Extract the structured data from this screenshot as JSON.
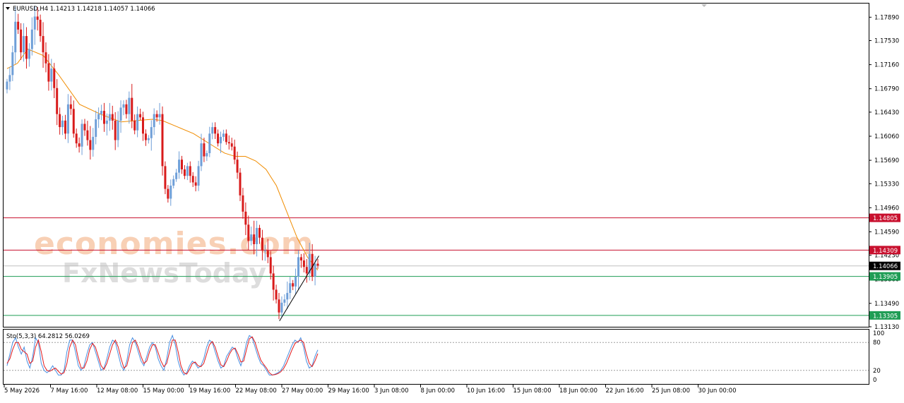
{
  "header": {
    "symbol_line": "EURUSD,H4  1.14213 1.14218 1.14057 1.14066"
  },
  "watermark": {
    "line1": "economies.com",
    "line2": "FxNewsToday"
  },
  "colors": {
    "bull": "#6f9fd8",
    "bear": "#d81b1b",
    "ma": "#f08c00",
    "resistance": "#c8102e",
    "support": "#1f9d55",
    "trendline": "#000000",
    "stoch_main": "#4a90e2",
    "stoch_signal": "#e31a1c"
  },
  "chart_data": [
    {
      "type": "candlestick",
      "title": "EURUSD,H4",
      "ohlc_readout": {
        "open": 1.14213,
        "high": 1.14218,
        "low": 1.14057,
        "close": 1.14066
      },
      "ylim": [
        1.1313,
        1.181
      ],
      "y_ticks": [
        "1.17890",
        "1.17530",
        "1.17160",
        "1.16790",
        "1.16430",
        "1.16060",
        "1.15690",
        "1.15330",
        "1.14960",
        "1.14590",
        "1.14230",
        "1.13860",
        "1.13490",
        "1.13130"
      ],
      "x_tick_labels": [
        "5 May 2026",
        "7 May 16:00",
        "12 May 08:00",
        "15 May 00:00",
        "19 May 16:00",
        "22 May 08:00",
        "27 May 00:00",
        "29 May 16:00",
        "3 Jun 08:00",
        "8 Jun 00:00",
        "10 Jun 16:00",
        "15 Jun 08:00",
        "18 Jun 00:00",
        "22 Jun 16:00",
        "25 Jun 08:00",
        "30 Jun 00:00"
      ],
      "series_close": [
        1.169,
        1.17,
        1.1735,
        1.1782,
        1.177,
        1.1735,
        1.176,
        1.1725,
        1.174,
        1.177,
        1.179,
        1.1785,
        1.176,
        1.1735,
        1.1718,
        1.169,
        1.171,
        1.168,
        1.164,
        1.162,
        1.163,
        1.161,
        1.1655,
        1.1648,
        1.161,
        1.1595,
        1.159,
        1.1625,
        1.1615,
        1.16,
        1.1585,
        1.1605,
        1.1632,
        1.164,
        1.1645,
        1.1625,
        1.163,
        1.164,
        1.163,
        1.16,
        1.163,
        1.165,
        1.1655,
        1.164,
        1.1665,
        1.163,
        1.1615,
        1.164,
        1.1635,
        1.161,
        1.16,
        1.1603,
        1.162,
        1.164,
        1.1635,
        1.164,
        1.156,
        1.1525,
        1.151,
        1.153,
        1.154,
        1.155,
        1.157,
        1.1555,
        1.1545,
        1.156,
        1.1545,
        1.1535,
        1.153,
        1.156,
        1.1595,
        1.1575,
        1.158,
        1.161,
        1.162,
        1.161,
        1.1595,
        1.1605,
        1.161,
        1.1597,
        1.1595,
        1.159,
        1.157,
        1.155,
        1.1515,
        1.149,
        1.147,
        1.1445,
        1.1455,
        1.144,
        1.1465,
        1.145,
        1.143,
        1.143,
        1.142,
        1.1395,
        1.137,
        1.1355,
        1.1335,
        1.135,
        1.1355,
        1.1365,
        1.138,
        1.1375,
        1.139,
        1.142,
        1.1415,
        1.1405,
        1.1395,
        1.1425,
        1.139,
        1.141,
        1.1407
      ],
      "moving_average": {
        "points": [
          [
            0,
            1.171
          ],
          [
            10,
            1.1718
          ],
          [
            20,
            1.174
          ],
          [
            35,
            1.173
          ],
          [
            50,
            1.17
          ],
          [
            70,
            1.1655
          ],
          [
            90,
            1.164
          ],
          [
            110,
            1.1628
          ],
          [
            125,
            1.163
          ],
          [
            140,
            1.1632
          ],
          [
            150,
            1.163
          ],
          [
            165,
            1.162
          ],
          [
            180,
            1.161
          ],
          [
            200,
            1.159
          ],
          [
            210,
            1.158
          ],
          [
            220,
            1.1575
          ],
          [
            230,
            1.1575
          ],
          [
            240,
            1.1568
          ],
          [
            250,
            1.1555
          ],
          [
            260,
            1.153
          ],
          [
            270,
            1.149
          ],
          [
            280,
            1.145
          ],
          [
            290,
            1.142
          ],
          [
            300,
            1.14
          ]
        ]
      },
      "price_lines": [
        {
          "value": 1.14805,
          "label": "1.14805",
          "kind": "resistance"
        },
        {
          "value": 1.14309,
          "label": "1.14309",
          "kind": "resistance"
        },
        {
          "value": 1.14066,
          "label": "1.14066",
          "kind": "current"
        },
        {
          "value": 1.13905,
          "label": "1.13905",
          "kind": "support"
        },
        {
          "value": 1.13305,
          "label": "1.13305",
          "kind": "support"
        }
      ],
      "trendline": {
        "from": [
          263,
          1.1322
        ],
        "to": [
          301,
          1.1422
        ]
      }
    },
    {
      "type": "line",
      "title": "Sto(5,3,3) 64.2812 56.0269",
      "ylim": [
        0,
        100
      ],
      "y_ticks": [
        "100",
        "80",
        "20",
        "0"
      ],
      "levels": [
        20,
        80
      ],
      "series": [
        {
          "name": "%K",
          "values": [
            30,
            55,
            80,
            90,
            70,
            55,
            70,
            40,
            25,
            50,
            90,
            80,
            35,
            20,
            15,
            20,
            30,
            20,
            10,
            10,
            20,
            60,
            85,
            85,
            60,
            30,
            20,
            30,
            55,
            75,
            80,
            60,
            40,
            20,
            25,
            45,
            70,
            85,
            80,
            55,
            30,
            20,
            40,
            75,
            90,
            80,
            60,
            40,
            30,
            50,
            70,
            80,
            70,
            45,
            30,
            20,
            45,
            80,
            95,
            75,
            40,
            20,
            10,
            15,
            30,
            40,
            35,
            25,
            30,
            45,
            70,
            85,
            80,
            60,
            40,
            25,
            30,
            50,
            60,
            70,
            65,
            45,
            30,
            50,
            80,
            95,
            90,
            70,
            50,
            35,
            30,
            20,
            10,
            10,
            12,
            15,
            20,
            30,
            45,
            60,
            75,
            85,
            80,
            90,
            70,
            40,
            25,
            30,
            50,
            64
          ]
        },
        {
          "name": "%D",
          "values": [
            35,
            45,
            65,
            80,
            80,
            65,
            60,
            55,
            35,
            40,
            70,
            85,
            60,
            30,
            20,
            18,
            22,
            25,
            18,
            12,
            15,
            35,
            70,
            85,
            75,
            45,
            25,
            25,
            40,
            65,
            78,
            70,
            50,
            30,
            22,
            35,
            55,
            75,
            85,
            70,
            45,
            25,
            30,
            55,
            80,
            85,
            70,
            50,
            35,
            40,
            60,
            75,
            75,
            58,
            40,
            28,
            35,
            60,
            85,
            85,
            60,
            30,
            15,
            12,
            22,
            35,
            38,
            30,
            28,
            35,
            55,
            75,
            82,
            70,
            50,
            32,
            28,
            40,
            55,
            65,
            68,
            55,
            38,
            40,
            65,
            88,
            92,
            80,
            60,
            42,
            33,
            25,
            15,
            10,
            11,
            13,
            17,
            24,
            35,
            50,
            65,
            78,
            82,
            85,
            80,
            55,
            35,
            28,
            40,
            56
          ]
        }
      ]
    }
  ]
}
